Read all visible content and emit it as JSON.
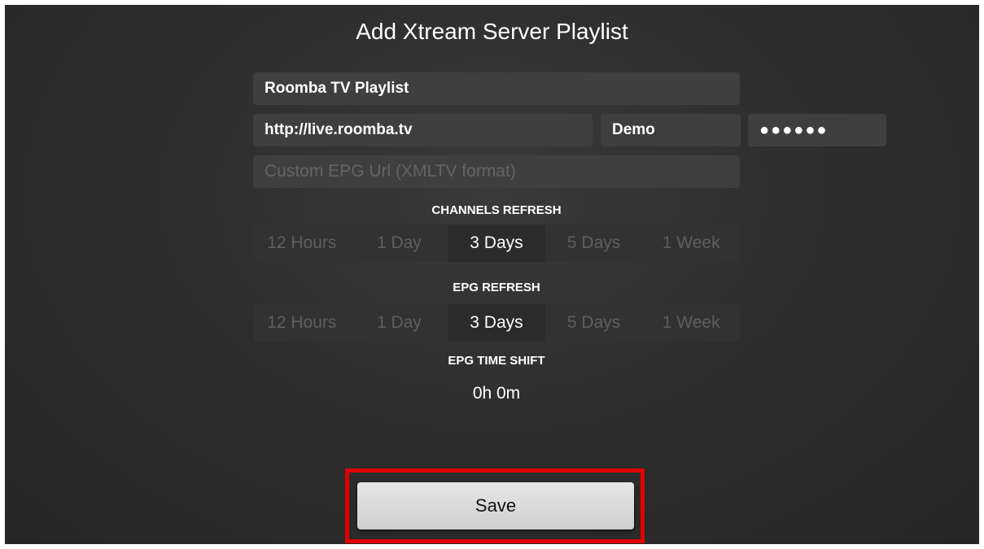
{
  "screen": {
    "title": "Add Xtream Server Playlist"
  },
  "form": {
    "playlist_name": "Roomba TV Playlist",
    "server_url": "http://live.roomba.tv",
    "username": "Demo",
    "password_masked": "●●●●●●",
    "epg_url_placeholder": "Custom EPG Url (XMLTV format)"
  },
  "channels_refresh": {
    "label": "CHANNELS REFRESH",
    "options": [
      "12 Hours",
      "1 Day",
      "3 Days",
      "5 Days",
      "1 Week"
    ],
    "selected": "3 Days"
  },
  "epg_refresh": {
    "label": "EPG REFRESH",
    "options": [
      "12 Hours",
      "1 Day",
      "3 Days",
      "5 Days",
      "1 Week"
    ],
    "selected": "3 Days"
  },
  "epg_time_shift": {
    "label": "EPG TIME SHIFT",
    "value": "0h 0m"
  },
  "actions": {
    "save_label": "Save"
  },
  "colors": {
    "highlight": "#e10000",
    "selected_text": "#ffffff",
    "unselected_text": "#5f5f5f"
  }
}
